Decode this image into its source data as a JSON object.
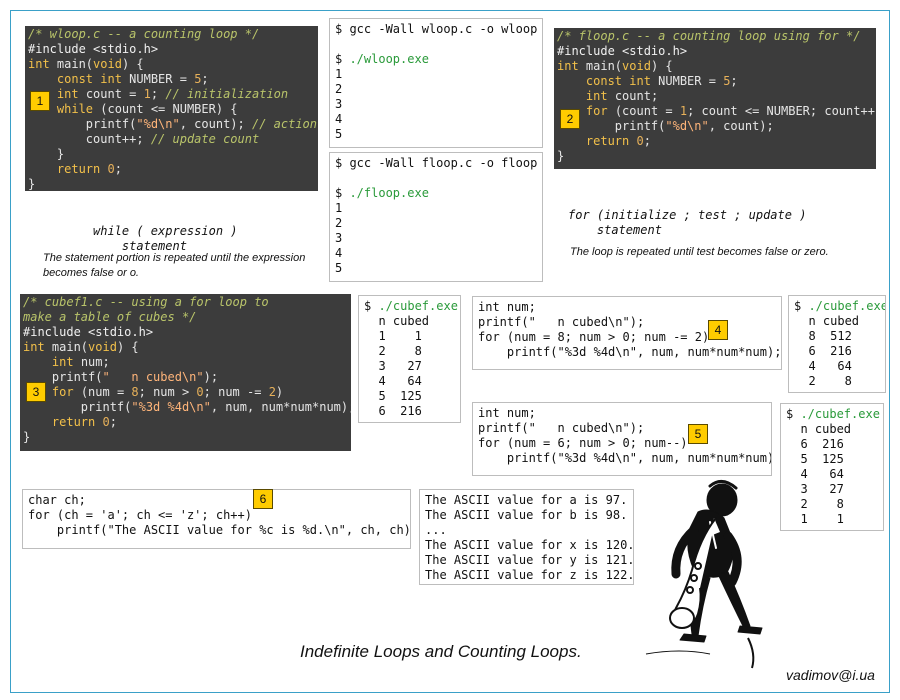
{
  "title": "Indefinite Loops and Counting Loops.",
  "author": "vadimov@i.ua",
  "wloop": {
    "badge": "1",
    "lines": [
      [
        [
          "c-com",
          "/* wloop.c -- a counting loop */"
        ]
      ],
      [
        [
          "c-pp",
          "#include <stdio.h>"
        ]
      ],
      [
        [
          "c-kw",
          "int"
        ],
        [
          "",
          " main("
        ],
        [
          "c-kw",
          "void"
        ],
        [
          "",
          ") {"
        ]
      ],
      [
        [
          "",
          "    "
        ],
        [
          "c-kw",
          "const int"
        ],
        [
          "",
          " NUMBER = "
        ],
        [
          "c-num",
          "5"
        ],
        [
          "",
          ";"
        ]
      ],
      [
        [
          "",
          "    "
        ],
        [
          "c-kw",
          "int"
        ],
        [
          "",
          " count = "
        ],
        [
          "c-num",
          "1"
        ],
        [
          "",
          "; "
        ],
        [
          "c-com",
          "// initialization"
        ]
      ],
      [
        [
          "",
          "    "
        ],
        [
          "c-kw",
          "while"
        ],
        [
          "",
          " (count <= NUMBER) {"
        ]
      ],
      [
        [
          "",
          "        printf("
        ],
        [
          "c-str",
          "\"%d\\n\""
        ],
        [
          "",
          ", count); "
        ],
        [
          "c-com",
          "// action"
        ]
      ],
      [
        [
          "",
          "        count++; "
        ],
        [
          "c-com",
          "// update count"
        ]
      ],
      [
        [
          "",
          "    }"
        ]
      ],
      [
        [
          "",
          "    "
        ],
        [
          "c-kw",
          "return"
        ],
        [
          "",
          " "
        ],
        [
          "c-num",
          "0"
        ],
        [
          "",
          ";"
        ]
      ],
      [
        [
          "",
          "}"
        ]
      ]
    ],
    "syntax_lines": [
      "while ( expression )",
      "    statement"
    ],
    "note": "The statement portion is repeated until the expression becomes false or o."
  },
  "wloop_term": {
    "lines": [
      [
        [
          "",
          "$ gcc -Wall wloop.c -o wloop"
        ]
      ],
      [
        [
          "",
          ""
        ]
      ],
      [
        [
          "",
          "$ "
        ],
        [
          "t-green",
          "./wloop.exe"
        ]
      ],
      [
        [
          "",
          "1"
        ]
      ],
      [
        [
          "",
          "2"
        ]
      ],
      [
        [
          "",
          "3"
        ]
      ],
      [
        [
          "",
          "4"
        ]
      ],
      [
        [
          "",
          "5"
        ]
      ]
    ]
  },
  "floop_term": {
    "lines": [
      [
        [
          "",
          "$ gcc -Wall floop.c -o floop"
        ]
      ],
      [
        [
          "",
          ""
        ]
      ],
      [
        [
          "",
          "$ "
        ],
        [
          "t-green",
          "./floop.exe"
        ]
      ],
      [
        [
          "",
          "1"
        ]
      ],
      [
        [
          "",
          "2"
        ]
      ],
      [
        [
          "",
          "3"
        ]
      ],
      [
        [
          "",
          "4"
        ]
      ],
      [
        [
          "",
          "5"
        ]
      ]
    ]
  },
  "floop": {
    "badge": "2",
    "lines": [
      [
        [
          "c-com",
          "/* floop.c -- a counting loop using for */"
        ]
      ],
      [
        [
          "c-pp",
          "#include <stdio.h>"
        ]
      ],
      [
        [
          "c-kw",
          "int"
        ],
        [
          "",
          " main("
        ],
        [
          "c-kw",
          "void"
        ],
        [
          "",
          ") {"
        ]
      ],
      [
        [
          "",
          "    "
        ],
        [
          "c-kw",
          "const int"
        ],
        [
          "",
          " NUMBER = "
        ],
        [
          "c-num",
          "5"
        ],
        [
          "",
          ";"
        ]
      ],
      [
        [
          "",
          "    "
        ],
        [
          "c-kw",
          "int"
        ],
        [
          "",
          " count;"
        ]
      ],
      [
        [
          "",
          "    "
        ],
        [
          "c-kw",
          "for"
        ],
        [
          "",
          " (count = "
        ],
        [
          "c-num",
          "1"
        ],
        [
          "",
          "; count <= NUMBER; count++)"
        ]
      ],
      [
        [
          "",
          "        printf("
        ],
        [
          "c-str",
          "\"%d\\n\""
        ],
        [
          "",
          ", count);"
        ]
      ],
      [
        [
          "",
          "    "
        ],
        [
          "c-kw",
          "return"
        ],
        [
          "",
          " "
        ],
        [
          "c-num",
          "0"
        ],
        [
          "",
          ";"
        ]
      ],
      [
        [
          "",
          "}"
        ]
      ]
    ],
    "syntax_lines": [
      "for (initialize ; test ; update )",
      "    statement"
    ],
    "note": "The loop is repeated until test becomes false or zero."
  },
  "cubef1": {
    "badge": "3",
    "lines": [
      [
        [
          "c-com",
          "/* cubef1.c -- using a for loop to"
        ]
      ],
      [
        [
          "c-com",
          "make a table of cubes */"
        ]
      ],
      [
        [
          "c-pp",
          "#include <stdio.h>"
        ]
      ],
      [
        [
          "c-kw",
          "int"
        ],
        [
          "",
          " main("
        ],
        [
          "c-kw",
          "void"
        ],
        [
          "",
          ") {"
        ]
      ],
      [
        [
          "",
          "    "
        ],
        [
          "c-kw",
          "int"
        ],
        [
          "",
          " num;"
        ]
      ],
      [
        [
          "",
          "    printf("
        ],
        [
          "c-str",
          "\"   n cubed\\n\""
        ],
        [
          "",
          ");"
        ]
      ],
      [
        [
          "",
          "    "
        ],
        [
          "c-kw",
          "for"
        ],
        [
          "",
          " (num = "
        ],
        [
          "c-num",
          "8"
        ],
        [
          "",
          "; num > "
        ],
        [
          "c-num",
          "0"
        ],
        [
          "",
          "; num -= "
        ],
        [
          "c-num",
          "2"
        ],
        [
          "",
          ")"
        ]
      ],
      [
        [
          "",
          "        printf("
        ],
        [
          "c-str",
          "\"%3d %4d\\n\""
        ],
        [
          "",
          ", num, num*num*num);"
        ]
      ],
      [
        [
          "",
          "    "
        ],
        [
          "c-kw",
          "return"
        ],
        [
          "",
          " "
        ],
        [
          "c-num",
          "0"
        ],
        [
          "",
          ";"
        ]
      ],
      [
        [
          "",
          "}"
        ]
      ]
    ]
  },
  "cube_out1": {
    "lines": [
      [
        [
          "",
          "$ "
        ],
        [
          "t-green",
          "./cubef.exe"
        ]
      ],
      [
        [
          "",
          "  n cubed"
        ]
      ],
      [
        [
          "",
          "  1    1"
        ]
      ],
      [
        [
          "",
          "  2    8"
        ]
      ],
      [
        [
          "",
          "  3   27"
        ]
      ],
      [
        [
          "",
          "  4   64"
        ]
      ],
      [
        [
          "",
          "  5  125"
        ]
      ],
      [
        [
          "",
          "  6  216"
        ]
      ]
    ]
  },
  "snip4": {
    "badge": "4",
    "lines": [
      [
        [
          "",
          "int num;"
        ]
      ],
      [
        [
          "",
          "printf(\"   n cubed\\n\");"
        ]
      ],
      [
        [
          "",
          "for (num = 8; num > 0; num -= 2)"
        ]
      ],
      [
        [
          "",
          "    printf(\"%3d %4d\\n\", num, num*num*num);"
        ]
      ]
    ]
  },
  "cube_out2": {
    "lines": [
      [
        [
          "",
          "$ "
        ],
        [
          "t-green",
          "./cubef.exe"
        ]
      ],
      [
        [
          "",
          "  n cubed"
        ]
      ],
      [
        [
          "",
          "  8  512"
        ]
      ],
      [
        [
          "",
          "  6  216"
        ]
      ],
      [
        [
          "",
          "  4   64"
        ]
      ],
      [
        [
          "",
          "  2    8"
        ]
      ]
    ]
  },
  "snip5": {
    "badge": "5",
    "lines": [
      [
        [
          "",
          "int num;"
        ]
      ],
      [
        [
          "",
          "printf(\"   n cubed\\n\");"
        ]
      ],
      [
        [
          "",
          "for (num = 6; num > 0; num--)"
        ]
      ],
      [
        [
          "",
          "    printf(\"%3d %4d\\n\", num, num*num*num);"
        ]
      ]
    ]
  },
  "cube_out3": {
    "lines": [
      [
        [
          "",
          "$ "
        ],
        [
          "t-green",
          "./cubef.exe"
        ]
      ],
      [
        [
          "",
          "  n cubed"
        ]
      ],
      [
        [
          "",
          "  6  216"
        ]
      ],
      [
        [
          "",
          "  5  125"
        ]
      ],
      [
        [
          "",
          "  4   64"
        ]
      ],
      [
        [
          "",
          "  3   27"
        ]
      ],
      [
        [
          "",
          "  2    8"
        ]
      ],
      [
        [
          "",
          "  1    1"
        ]
      ]
    ]
  },
  "snip6": {
    "badge": "6",
    "lines": [
      [
        [
          "",
          "char ch;"
        ]
      ],
      [
        [
          "",
          "for (ch = 'a'; ch <= 'z'; ch++)"
        ]
      ],
      [
        [
          "",
          "    printf(\"The ASCII value for %c is %d.\\n\", ch, ch);"
        ]
      ]
    ]
  },
  "ascii_out": {
    "lines": [
      [
        [
          "",
          "The ASCII value for a is 97."
        ]
      ],
      [
        [
          "",
          "The ASCII value for b is 98."
        ]
      ],
      [
        [
          "",
          "..."
        ]
      ],
      [
        [
          "",
          "The ASCII value for x is 120."
        ]
      ],
      [
        [
          "",
          "The ASCII value for y is 121."
        ]
      ],
      [
        [
          "",
          "The ASCII value for z is 122."
        ]
      ]
    ]
  },
  "illustration": {
    "icon": "saxophone-player-illustration"
  }
}
